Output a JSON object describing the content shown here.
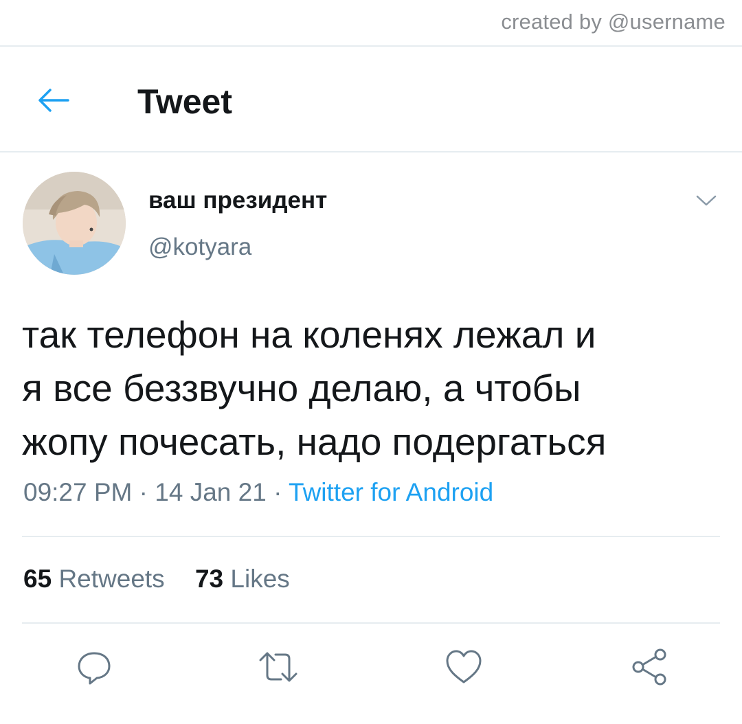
{
  "watermark": "created by @username",
  "header": {
    "back_icon": "back-arrow-icon",
    "title": "Tweet",
    "accent": "#1da1f2"
  },
  "tweet": {
    "display_name": "ваш президент",
    "handle": "@kotyara",
    "text_lines": [
      "так телефон на коленях лежал и",
      "я все беззвучно делаю, а чтобы",
      "жопу почесать, надо подергаться"
    ],
    "time": "09:27 PM",
    "date": "14 Jan 21",
    "separator": "·",
    "source": "Twitter for Android",
    "retweets_count": "65",
    "retweets_label": "Retweets",
    "likes_count": "73",
    "likes_label": "Likes"
  },
  "actions": [
    {
      "icon": "reply-icon"
    },
    {
      "icon": "retweet-icon"
    },
    {
      "icon": "like-icon"
    },
    {
      "icon": "share-icon"
    }
  ],
  "colors": {
    "text_primary": "#14171a",
    "text_secondary": "#657786",
    "link": "#1da1f2",
    "divider": "#e6ecf0"
  }
}
